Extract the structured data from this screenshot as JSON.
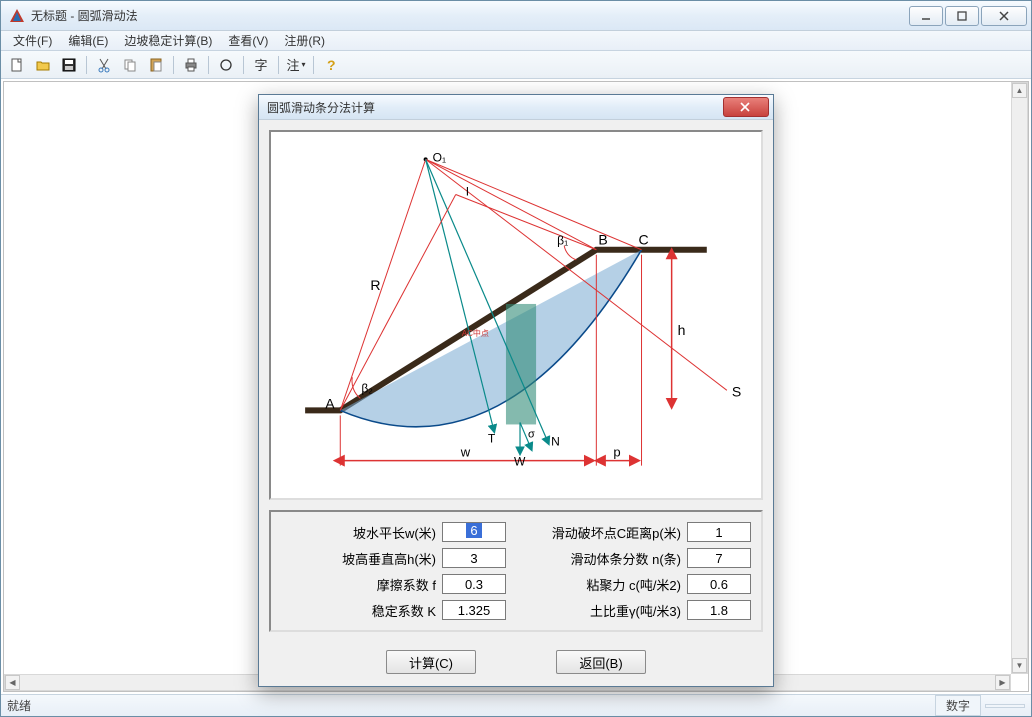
{
  "window": {
    "title": "无标题 - 圆弧滑动法"
  },
  "menu": {
    "file": "文件(F)",
    "edit": "编辑(E)",
    "slope": "边坡稳定计算(B)",
    "view": "查看(V)",
    "register": "注册(R)"
  },
  "toolbar_icons": {
    "new": "new-file-icon",
    "open": "open-folder-icon",
    "save": "save-icon",
    "cut": "cut-icon",
    "copy": "copy-icon",
    "paste": "paste-icon",
    "print": "print-icon",
    "circle": "circle-icon",
    "char": "字",
    "note": "注",
    "help": "help-icon"
  },
  "status": {
    "ready": "就绪",
    "num": "数字"
  },
  "dialog": {
    "title": "圆弧滑动条分法计算",
    "labels": {
      "w": "坡水平长w(米)",
      "h": "坡高垂直高h(米)",
      "f": "摩擦系数 f",
      "K": "稳定系数 K",
      "p": "滑动破坏点C距离p(米)",
      "n": "滑动体条分数 n(条)",
      "c": "粘聚力 c(吨/米2)",
      "gamma": "土比重γ(吨/米3)"
    },
    "values": {
      "w": "6",
      "h": "3",
      "f": "0.3",
      "K": "1.325",
      "p": "1",
      "n": "7",
      "c": "0.6",
      "gamma": "1.8"
    },
    "buttons": {
      "calc": "计算(C)",
      "back": "返回(B)"
    },
    "diagram": {
      "O": "O₁",
      "I": "I",
      "R": "R",
      "A": "A",
      "B": "B",
      "C": "C",
      "S": "S",
      "T": "T",
      "N": "N",
      "W": "W",
      "sigma": "σ",
      "beta1": "β₁",
      "beta2": "β₂",
      "h": "h",
      "p": "p",
      "w": "w",
      "mid": "AC中点"
    }
  }
}
